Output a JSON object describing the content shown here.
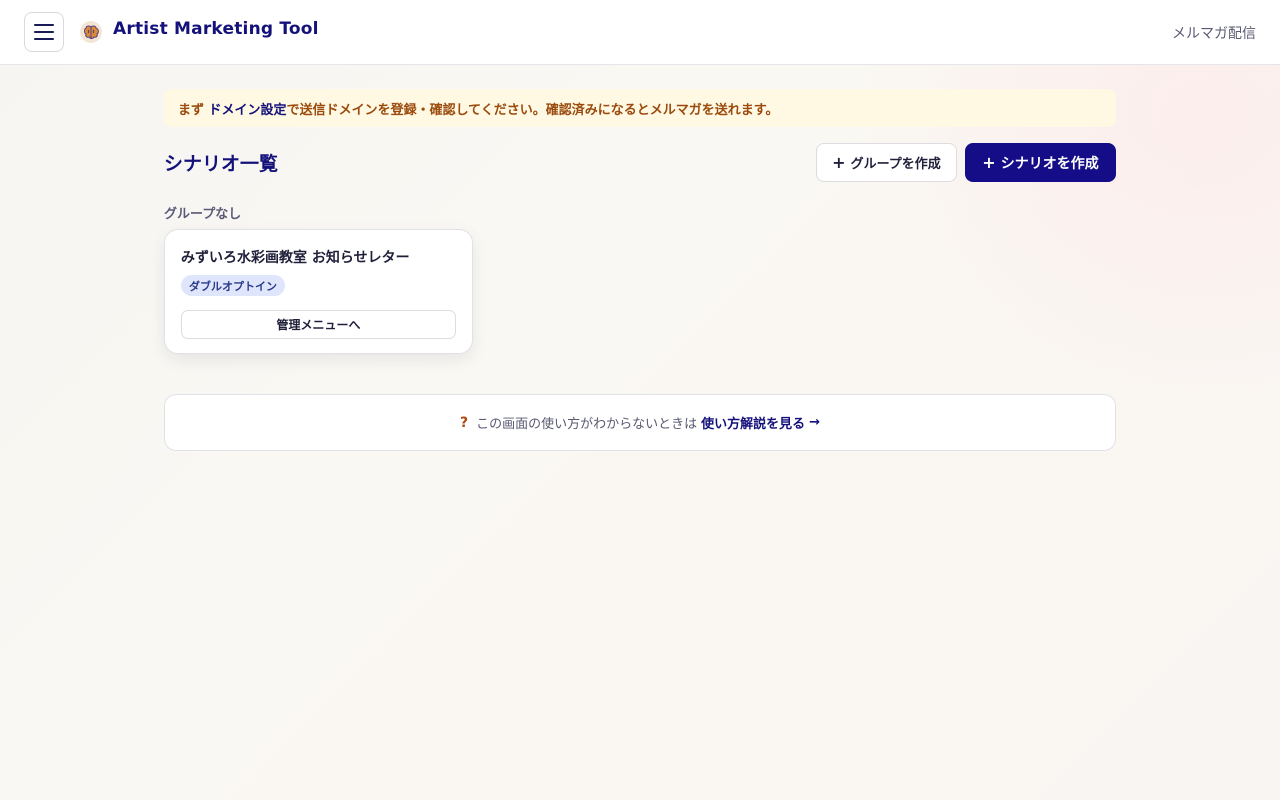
{
  "header": {
    "app_name": "Artist Marketing Tool",
    "nav_link": "メルマガ配信"
  },
  "notice": {
    "prefix": "まず",
    "link": "ドメイン設定",
    "suffix": "で送信ドメインを登録・確認してください。確認済みになるとメルマガを送れます。"
  },
  "page": {
    "title": "シナリオ一覧",
    "create_group_label": "グループを作成",
    "create_scenario_label": "シナリオを作成"
  },
  "groups": [
    {
      "label": "グループなし",
      "scenarios": [
        {
          "title": "みずいろ水彩画教室 お知らせレター",
          "badge": "ダブルオプトイン",
          "button_label": "管理メニューへ"
        }
      ]
    }
  ],
  "help": {
    "icon": "question-icon",
    "text": "この画面の使い方がわからないときは",
    "link": "使い方解説を見る",
    "arrow": "→"
  },
  "colors": {
    "primary": "#140d87",
    "notice_bg": "#fff9e3",
    "notice_text": "#9a4a0c",
    "badge_bg": "#dfe6fb"
  }
}
